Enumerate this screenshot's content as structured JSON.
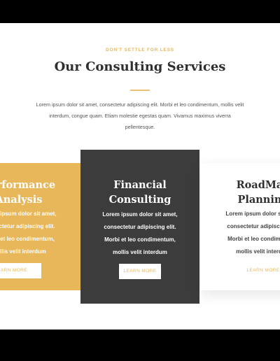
{
  "section": {
    "eyebrow": "DON'T SETTLE FOR LESS",
    "title": "Our Consulting Services",
    "intro": "Lorem ipsum dolor sit amet, consectetur adipiscing elit. Morbi et leo condimentum, mollis velit interdum, congue quam. Etiam molestie egestas quam. Vivamus maximus viverra pellentesque."
  },
  "cards": [
    {
      "title_line1": "Performance",
      "title_line2": "Analysis",
      "body_lines": [
        "Lorem ipsum dolor sit amet,",
        "consectetur adipiscing elit.",
        "Morbi et leo condimentum,",
        "mollis velit interdum"
      ],
      "button": "LEARN MORE"
    },
    {
      "title_line1": "Financial",
      "title_line2": "Consulting",
      "body_lines": [
        "Lorem ipsum dolor sit amet,",
        "consectetur adipiscing elit.",
        "Morbi et leo condimentum,",
        "mollis velit interdum"
      ],
      "button": "LEARN MORE"
    },
    {
      "title_line1": "RoadMap",
      "title_line2": "Planning",
      "body_lines": [
        "Lorem ipsum dolor sit amet,",
        "consectetur adipiscing elit.",
        "Morbi et leo condimentum,",
        "mollis velit interdum"
      ],
      "button": "LEARN MORE"
    }
  ],
  "colors": {
    "accent": "#e8b75a",
    "dark_card": "#3c3c3c",
    "heading": "#2f2f2f"
  }
}
